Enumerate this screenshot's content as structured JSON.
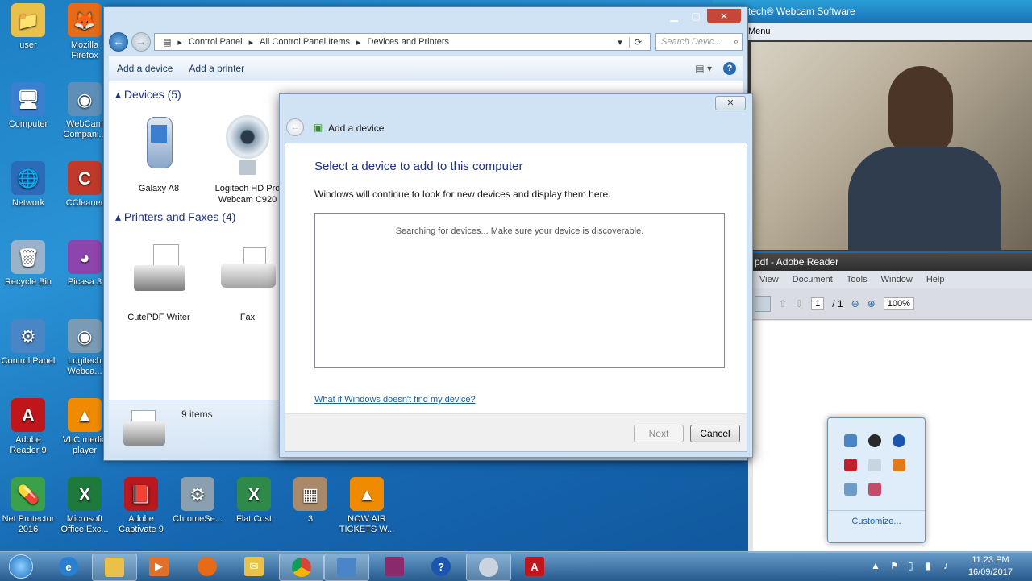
{
  "desktop_icons": [
    {
      "label": "user",
      "glyph": "📁",
      "color": "#e8c04a"
    },
    {
      "label": "Mozilla Firefox",
      "glyph": "🦊",
      "color": "#e66a17"
    },
    {
      "label": "Computer",
      "glyph": "🖥",
      "color": "#3b7fd0"
    },
    {
      "label": "WebCam Compani...",
      "glyph": "◉",
      "color": "#5d8fb8"
    },
    {
      "label": "Network",
      "glyph": "🌐",
      "color": "#2c6bb8"
    },
    {
      "label": "CCleaner",
      "glyph": "C",
      "color": "#c0392b"
    },
    {
      "label": "Recycle Bin",
      "glyph": "🗑",
      "color": "#9bb3c8"
    },
    {
      "label": "Picasa 3",
      "glyph": "◕",
      "color": "#8e44ad"
    },
    {
      "label": "Control Panel",
      "glyph": "⚙",
      "color": "#4a86c5"
    },
    {
      "label": "Logitech Webca...",
      "glyph": "◉",
      "color": "#7a9bb5"
    },
    {
      "label": "Adobe Reader 9",
      "glyph": "A",
      "color": "#c0151a"
    },
    {
      "label": "VLC media player",
      "glyph": "▲",
      "color": "#f08a00"
    },
    {
      "label": "Net Protector 2016",
      "glyph": "💊",
      "color": "#3aa04a"
    },
    {
      "label": "Microsoft Office Exc...",
      "glyph": "X",
      "color": "#1e7a3c"
    },
    {
      "label": "Adobe Captivate 9",
      "glyph": "📕",
      "color": "#b8181e"
    },
    {
      "label": "ChromeSe...",
      "glyph": "⚙",
      "color": "#8aa0b0"
    },
    {
      "label": "Flat Cost",
      "glyph": "X",
      "color": "#2f8a4a"
    },
    {
      "label": "3",
      "glyph": "▦",
      "color": "#a88a6a"
    },
    {
      "label": "NOW AIR TICKETS W...",
      "glyph": "▲",
      "color": "#f08a00"
    }
  ],
  "webcam_window": {
    "title": "tech® Webcam Software",
    "menu": "Menu"
  },
  "reader_window": {
    "title": "pdf - Adobe Reader",
    "menu": [
      "View",
      "Document",
      "Tools",
      "Window",
      "Help"
    ],
    "page_current": "1",
    "page_total": "/ 1",
    "zoom": "100%"
  },
  "explorer": {
    "breadcrumb": [
      "Control Panel",
      "All Control Panel Items",
      "Devices and Printers"
    ],
    "search_placeholder": "Search Devic...",
    "commands": [
      "Add a device",
      "Add a printer"
    ],
    "groups": {
      "devices": "Devices (5)",
      "printers": "Printers and Faxes (4)"
    },
    "devices": [
      "Galaxy A8",
      "Logitech HD Pro Webcam C920"
    ],
    "printers": [
      "CutePDF Writer",
      "Fax"
    ],
    "item_count": "9 items"
  },
  "dialog": {
    "title": "Add a device",
    "heading": "Select a device to add to this computer",
    "subtext": "Windows will continue to look for new devices and display them here.",
    "status": "Searching for devices...  Make sure your device is discoverable.",
    "help_link": "What if Windows doesn't find my device?",
    "next": "Next",
    "cancel": "Cancel"
  },
  "tray_popup": {
    "customize": "Customize..."
  },
  "clock": {
    "time": "11:23 PM",
    "date": "16/09/2017"
  }
}
